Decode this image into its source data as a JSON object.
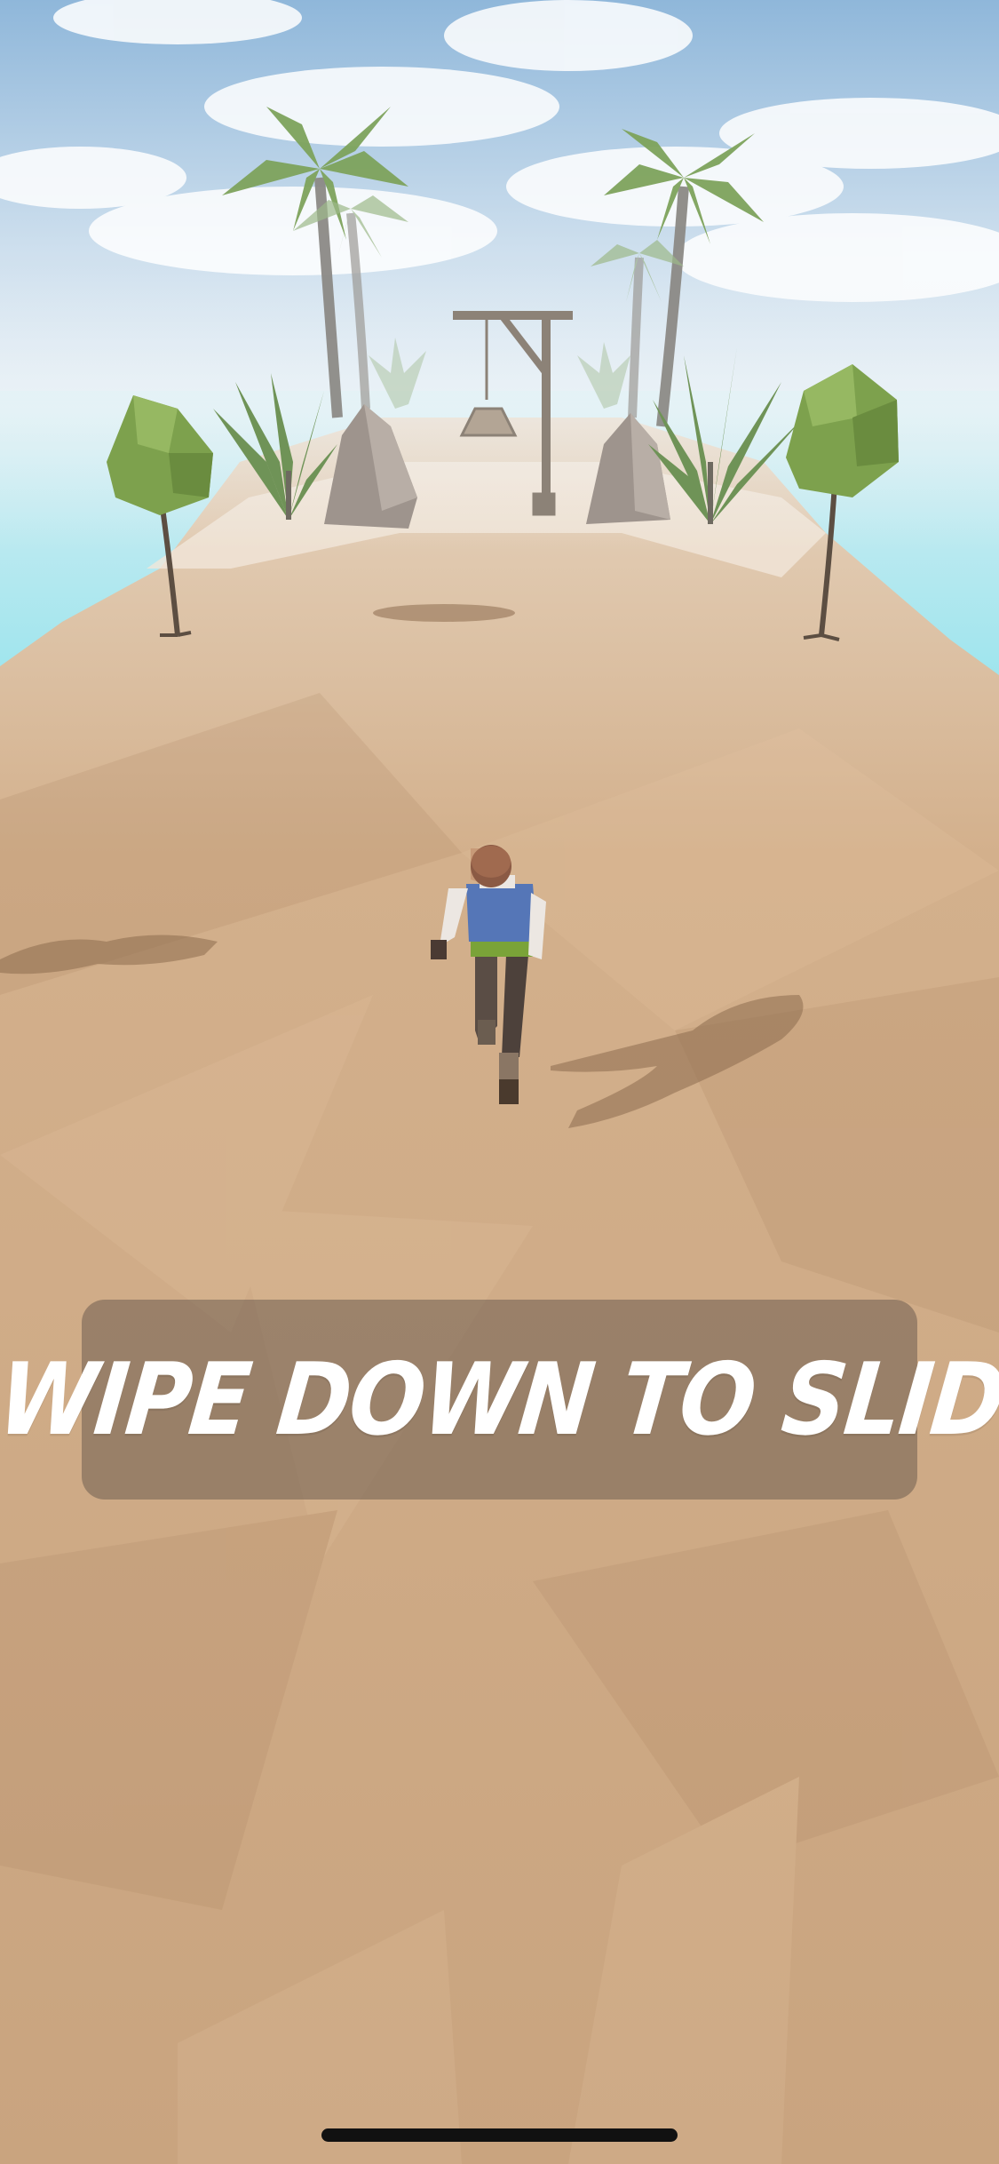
{
  "tutorial": {
    "instruction_text": "SWIPE DOWN TO SLIDE"
  },
  "colors": {
    "sky": "#bcd7ea",
    "sea": "#8fe0ea",
    "sand": "#c9a47f",
    "banner": "#6e5c50",
    "banner_text": "#ffffff"
  }
}
